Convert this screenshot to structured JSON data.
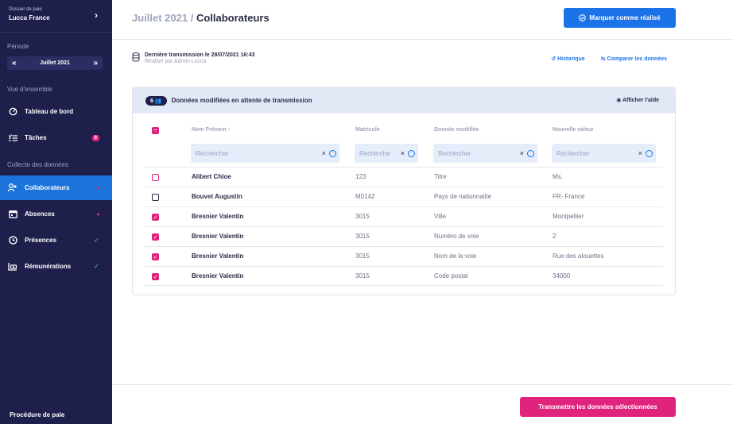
{
  "sidebar": {
    "dossier_label": "Dossier de paie",
    "dossier_name": "Lucca France",
    "periode_title": "Période",
    "periode_value": "Juillet 2021",
    "overview_title": "Vue d'ensemble",
    "collect_title": "Collecte des données",
    "items": [
      {
        "label": "Tableau de bord"
      },
      {
        "label": "Tâches",
        "badge": "8"
      },
      {
        "label": "Collaborateurs"
      },
      {
        "label": "Absences"
      },
      {
        "label": "Présences"
      },
      {
        "label": "Rémunérations"
      }
    ],
    "footer": "Procédure de paie"
  },
  "header": {
    "title_muted": "Juillet 2021 /",
    "title": "Collaborateurs",
    "primary_button": "Marquer comme réalisé"
  },
  "info": {
    "line1": "Dernière transmission le 28/07/2021 16:43",
    "line2": "Réalisé par Admin Lucca",
    "historique": "Historique",
    "comparer": "Comparer les données"
  },
  "card": {
    "count": "6",
    "title": "Données modifiées en attente de transmission",
    "help": "Afficher l'aide",
    "columns": [
      "Nom Prénom",
      "Matricule",
      "Donnée modifiée",
      "Nouvelle valeur"
    ],
    "search_placeholders": [
      "Rechercher",
      "Recherche",
      "Rechercher",
      "Rechercher"
    ],
    "rows": [
      {
        "name": "Alibert Chloe",
        "matricule": "123",
        "donnee": "Titre",
        "valeur": "Ms.",
        "checked": false
      },
      {
        "name": "Bouvet Augustin",
        "matricule": "M0142",
        "donnee": "Pays de nationnalité",
        "valeur": "FR- France",
        "checked": false
      },
      {
        "name": "Bresnier Valentin",
        "matricule": "3015",
        "donnee": "Ville",
        "valeur": "Montpellier",
        "checked": true
      },
      {
        "name": "Bresnier Valentin",
        "matricule": "3015",
        "donnee": "Numéro de voie",
        "valeur": "2",
        "checked": true
      },
      {
        "name": "Bresnier Valentin",
        "matricule": "3015",
        "donnee": "Nom de la voie",
        "valeur": "Rue des alouettes",
        "checked": true
      },
      {
        "name": "Bresnier Valentin",
        "matricule": "3015",
        "donnee": "Code postal",
        "valeur": "34000",
        "checked": true
      }
    ]
  },
  "footer_button": "Transmettre les données sélectionnées",
  "colors": {
    "sidebar": "#1e1f4b",
    "primary": "#1c73e8",
    "pink": "#e0237c",
    "green": "#37c46a"
  }
}
